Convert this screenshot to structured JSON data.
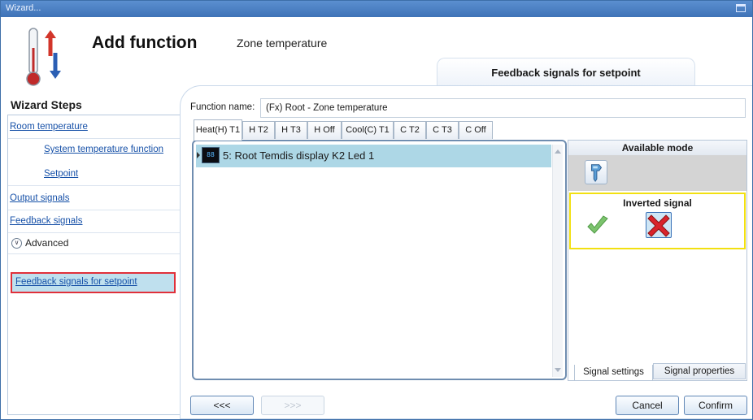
{
  "window": {
    "title": "Wizard..."
  },
  "header": {
    "title": "Add function",
    "subtitle": "Zone temperature",
    "page_tab": "Feedback signals for setpoint"
  },
  "steps": {
    "heading": "Wizard Steps",
    "items": [
      {
        "label": "Room temperature"
      },
      {
        "label": "System temperature function"
      },
      {
        "label": "Setpoint"
      },
      {
        "label": "Output signals"
      },
      {
        "label": "Feedback signals"
      }
    ],
    "advanced_label": "Advanced",
    "selected_label": "Feedback signals for setpoint"
  },
  "function_name": {
    "label": "Function name:",
    "value": "(Fx) Root - Zone temperature"
  },
  "tabs": [
    {
      "label": "Heat(H) T1",
      "active": true
    },
    {
      "label": "H T2"
    },
    {
      "label": "H T3"
    },
    {
      "label": "H Off"
    },
    {
      "label": "Cool(C) T1"
    },
    {
      "label": "C T2"
    },
    {
      "label": "C T3"
    },
    {
      "label": "C Off"
    }
  ],
  "signals": [
    {
      "label": "5: Root Temdis display K2 Led 1",
      "icon_text": "88"
    }
  ],
  "right_panel": {
    "available_mode_label": "Available mode",
    "inverted_signal_label": "Inverted signal",
    "tabs": [
      {
        "label": "Signal settings"
      },
      {
        "label": "Signal properties"
      }
    ]
  },
  "footer": {
    "back": "<<<",
    "next": ">>>",
    "cancel": "Cancel",
    "confirm": "Confirm"
  },
  "colors": {
    "titlebar": "#4a7fc4",
    "selected_row": "#add7e6",
    "highlight_red": "#e0303a",
    "highlight_yellow": "#f2e011"
  }
}
